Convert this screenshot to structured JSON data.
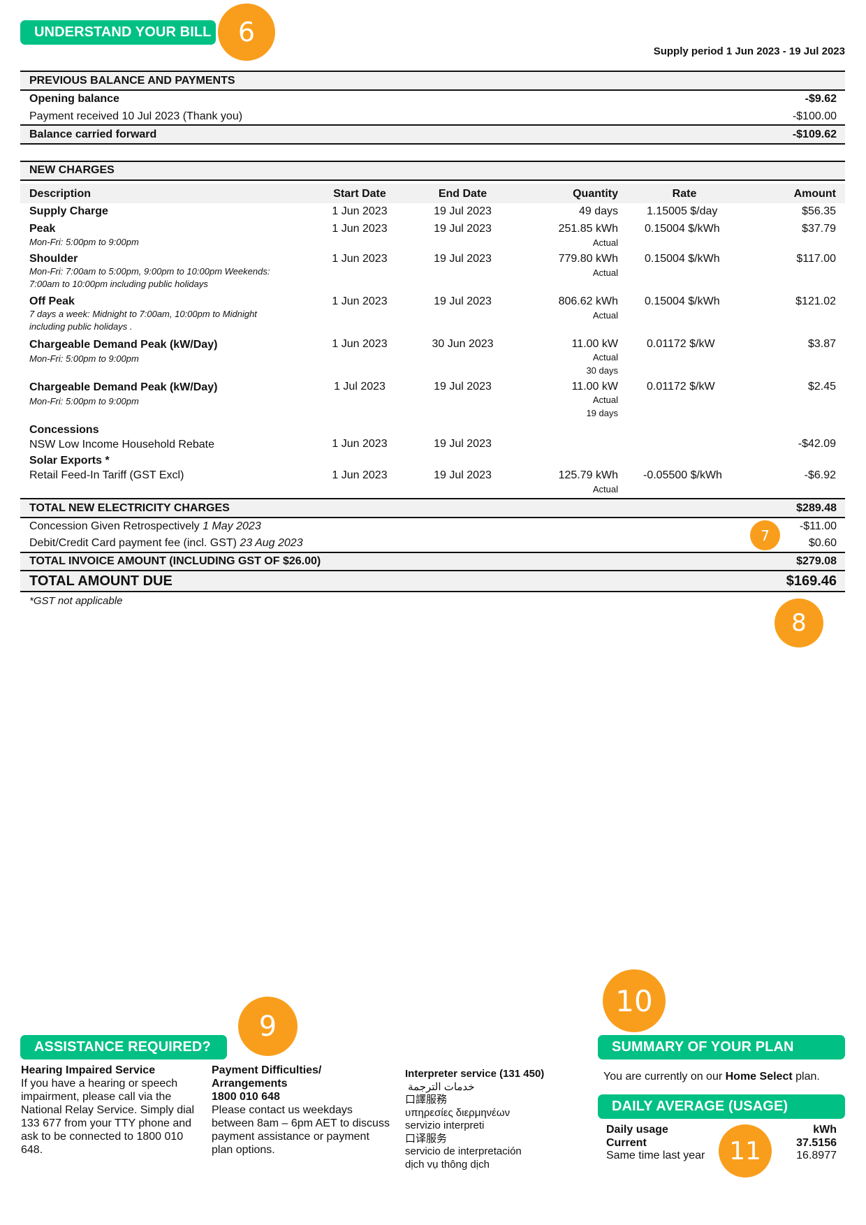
{
  "header": {
    "section_title": "UNDERSTAND YOUR BILL",
    "supply_period": "Supply period 1 Jun 2023 - 19 Jul 2023"
  },
  "badges": {
    "b6": "6",
    "b7": "7",
    "b8": "8",
    "b9": "9",
    "b10": "10",
    "b11": "11"
  },
  "colors": {
    "accent_green": "#00c083",
    "badge_orange": "#f99e1c",
    "band_grey": "#f1f1f1"
  },
  "previous_balance": {
    "title": "PREVIOUS BALANCE AND PAYMENTS",
    "rows": [
      {
        "label": "Opening balance",
        "amount": "-$9.62"
      },
      {
        "label": "Payment received 10 Jul 2023 (Thank you)",
        "amount": "-$100.00"
      }
    ],
    "carried_forward": {
      "label": "Balance carried forward",
      "amount": "-$109.62"
    }
  },
  "new_charges": {
    "title": "NEW CHARGES",
    "columns": [
      "Description",
      "Start Date",
      "End Date",
      "Quantity",
      "Rate",
      "Amount"
    ],
    "rows": [
      {
        "desc": "Supply Charge",
        "note": "",
        "start": "1 Jun 2023",
        "end": "19 Jul 2023",
        "qty": "49 days",
        "qty_note": "",
        "qty_note2": "",
        "rate": "1.15005 $/day",
        "amount": "$56.35"
      },
      {
        "desc": "Peak",
        "note": "Mon-Fri: 5:00pm to 9:00pm",
        "start": "1 Jun 2023",
        "end": "19 Jul 2023",
        "qty": "251.85 kWh",
        "qty_note": "Actual",
        "qty_note2": "",
        "rate": "0.15004 $/kWh",
        "amount": "$37.79"
      },
      {
        "desc": "Shoulder",
        "note": "Mon-Fri: 7:00am to 5:00pm, 9:00pm to 10:00pm Weekends:",
        "note2": "7:00am to 10:00pm including public holidays",
        "start": "1 Jun 2023",
        "end": "19 Jul 2023",
        "qty": "779.80 kWh",
        "qty_note": "Actual",
        "qty_note2": "",
        "rate": "0.15004 $/kWh",
        "amount": "$117.00"
      },
      {
        "desc": "Off Peak",
        "note": "7 days a week: Midnight to 7:00am, 10:00pm to Midnight",
        "note2": "including public holidays .",
        "start": "1 Jun 2023",
        "end": "19 Jul 2023",
        "qty": "806.62 kWh",
        "qty_note": "Actual",
        "qty_note2": "",
        "rate": "0.15004 $/kWh",
        "amount": "$121.02"
      },
      {
        "desc": "Chargeable Demand Peak (kW/Day)",
        "note": "Mon-Fri: 5:00pm to 9:00pm",
        "start": "1 Jun 2023",
        "end": "30 Jun 2023",
        "qty": "11.00 kW",
        "qty_note": "Actual",
        "qty_note2": "30 days",
        "rate": "0.01172 $/kW",
        "amount": "$3.87"
      },
      {
        "desc": "Chargeable Demand Peak (kW/Day)",
        "note": "Mon-Fri: 5:00pm to 9:00pm",
        "start": "1 Jul 2023",
        "end": "19 Jul 2023",
        "qty": "11.00 kW",
        "qty_note": "Actual",
        "qty_note2": "19 days",
        "rate": "0.01172 $/kW",
        "amount": "$2.45"
      }
    ],
    "concessions": {
      "heading": "Concessions",
      "label": "NSW Low Income Household Rebate",
      "start": "1 Jun 2023",
      "end": "19 Jul 2023",
      "amount": "-$42.09"
    },
    "solar": {
      "heading": "Solar Exports *",
      "label": "Retail Feed-In Tariff (GST Excl)",
      "start": "1 Jun 2023",
      "end": "19 Jul 2023",
      "qty": "125.79 kWh",
      "qty_note": "Actual",
      "rate": "-0.05500 $/kWh",
      "amount": "-$6.92"
    }
  },
  "totals": {
    "electricity": {
      "label": "TOTAL NEW ELECTRICITY CHARGES",
      "amount": "$289.48"
    },
    "adjustments": [
      {
        "label": "Concession Given Retrospectively ",
        "date": "1 May 2023",
        "amount": "-$11.00"
      },
      {
        "label": "Debit/Credit Card payment fee (incl. GST) ",
        "date": "23 Aug 2023",
        "amount": "$0.60"
      }
    ],
    "invoice": {
      "label": "TOTAL INVOICE AMOUNT (INCLUDING GST OF $26.00)",
      "amount": "$279.08"
    },
    "due": {
      "label": "TOTAL AMOUNT DUE",
      "amount": "$169.46"
    },
    "footnote": "*GST not applicable"
  },
  "assistance": {
    "title": "ASSISTANCE REQUIRED?",
    "hearing": {
      "heading": "Hearing Impaired Service",
      "lines": [
        "If you have a hearing or speech",
        "impairment, please call via the",
        "National Relay Service. Simply dial",
        "133 677 from your TTY phone and",
        "ask to be connected to 1800 010",
        "648."
      ]
    },
    "payment": {
      "heading1": "Payment Difficulties/",
      "heading2": "Arrangements",
      "phone": "1800 010 648",
      "lines": [
        "Please contact us weekdays",
        "between 8am – 6pm AET to discuss",
        "payment assistance or payment",
        "plan options."
      ]
    },
    "interpreter": {
      "heading": "Interpreter service (131 450)",
      "lines": [
        "خدمات الترجمة",
        "口譯服務",
        "υπηρεσίες διερμηνέων",
        "servizio interpreti",
        "口译服务",
        "servicio de interpretación",
        "dịch vụ thông dịch"
      ]
    }
  },
  "plan": {
    "title": "SUMMARY OF YOUR PLAN",
    "text_before": "You are currently on our ",
    "plan_name": "Home Select",
    "text_after": " plan."
  },
  "daily_average": {
    "title": "DAILY AVERAGE (USAGE)",
    "header_label": "Daily usage",
    "unit": "kWh",
    "rows": [
      {
        "label": "Current",
        "value": "37.5156"
      },
      {
        "label": "Same time last year",
        "value": "16.8977"
      }
    ]
  }
}
